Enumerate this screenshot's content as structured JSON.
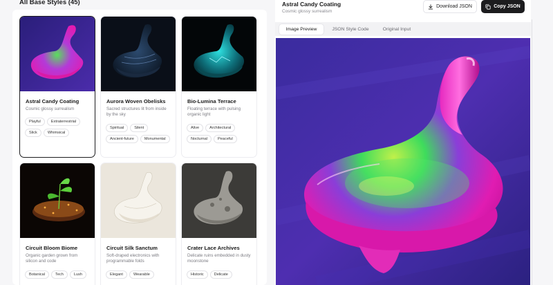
{
  "left_panel": {
    "title": "All Base Styles (45)",
    "cards": [
      {
        "title": "Astral Candy Coating",
        "subtitle": "Cosmic glossy surrealism",
        "tags": [
          "Playful",
          "Extraterrestrial",
          "Slick",
          "Whimsical"
        ],
        "selected": true,
        "image": "astral-candy-spinning-top"
      },
      {
        "title": "Aurora Woven Obelisks",
        "subtitle": "Sacred structures lit from inside by the sky",
        "tags": [
          "Spiritual",
          "Silent",
          "Ancient-future",
          "Monumental"
        ],
        "selected": false,
        "image": "woven-spinning-top"
      },
      {
        "title": "Bio-Lumina Terrace",
        "subtitle": "Floating terrace with pulsing organic light",
        "tags": [
          "Alive",
          "Architectural",
          "Nocturnal",
          "Peaceful"
        ],
        "selected": false,
        "image": "bioluminescent-spinning-top"
      },
      {
        "title": "Circuit Bloom Biome",
        "subtitle": "Organic garden grown from silicon and code",
        "tags": [
          "Botanical",
          "Tech",
          "Lush"
        ],
        "selected": false,
        "image": "circuit-garden-platform"
      },
      {
        "title": "Circuit Silk Sanctum",
        "subtitle": "Soft-draped electronics with programmable folds",
        "tags": [
          "Elegant",
          "Wearable"
        ],
        "selected": false,
        "image": "silk-spinning-top"
      },
      {
        "title": "Crater Lace Archives",
        "subtitle": "Delicate ruins embedded in dusty moonstone",
        "tags": [
          "Historic",
          "Delicate"
        ],
        "selected": false,
        "image": "moonstone-spinning-top"
      }
    ]
  },
  "right_panel": {
    "title": "Astral Candy Coating",
    "subtitle": "Cosmic glossy surrealism",
    "download_label": "Download JSON",
    "copy_label": "Copy JSON",
    "tabs": [
      {
        "label": "Image Preview",
        "active": true
      },
      {
        "label": "JSON Style Code",
        "active": false
      },
      {
        "label": "Original Input",
        "active": false
      }
    ],
    "preview_image": "astral-candy-spinning-top"
  },
  "icons": {
    "download": "download-icon",
    "copy": "copy-icon"
  },
  "colors": {
    "accent_dark": "#1c1c1e",
    "candy_magenta": "#e21fb0",
    "candy_green": "#3ee05a",
    "space_purple": "#3b2a9a"
  }
}
